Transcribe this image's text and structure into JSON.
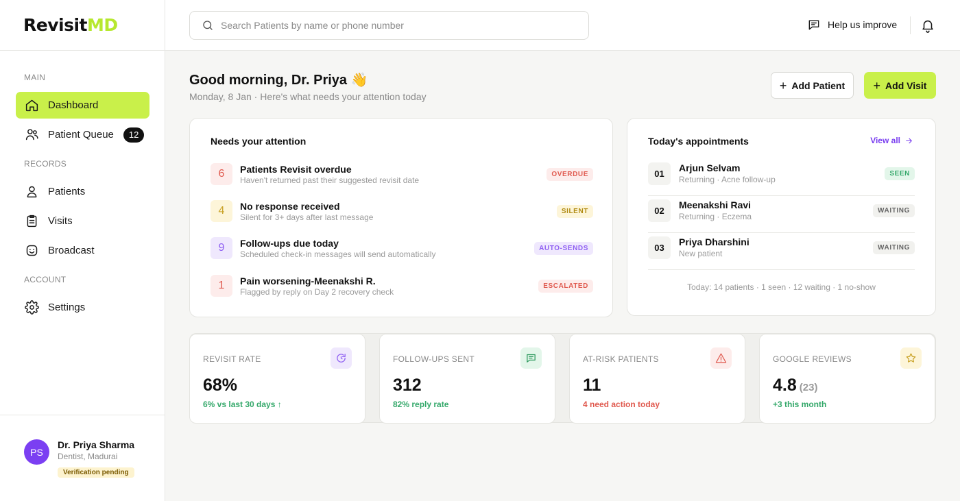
{
  "logo": {
    "part1": "Revisit",
    "part2": "MD"
  },
  "sidebar": {
    "sections": [
      "MAIN",
      "RECORDS",
      "ACCOUNT"
    ],
    "items": [
      {
        "label": "Dashboard"
      },
      {
        "label": "Patient Queue",
        "badge": "12"
      },
      {
        "label": "Patients"
      },
      {
        "label": "Visits"
      },
      {
        "label": "Broadcast"
      },
      {
        "label": "Settings"
      }
    ],
    "profile": {
      "initials": "PS",
      "name": "Dr. Priya Sharma",
      "role": "Dentist, Madurai",
      "status": "Verification pending"
    }
  },
  "topbar": {
    "search_placeholder": "Search Patients by name or phone number",
    "help_label": "Help us improve"
  },
  "header": {
    "greeting": "Good morning, Dr. Priya 👋",
    "subtitle": "Monday, 8 Jan · Here's what needs your attention today",
    "add_patient": "Add Patient",
    "add_visit": "Add Visit"
  },
  "attention": {
    "title": "Needs your attention",
    "items": [
      {
        "count": "6",
        "title": "Patients Revisit overdue",
        "sub": "Haven't returned past their suggested revisit date",
        "tag": "OVERDUE"
      },
      {
        "count": "4",
        "title": "No response received",
        "sub": "Silent for 3+ days after last message",
        "tag": "SILENT"
      },
      {
        "count": "9",
        "title": "Follow-ups due today",
        "sub": "Scheduled check-in messages will send automatically",
        "tag": "AUTO-SENDS"
      },
      {
        "count": "1",
        "title": "Pain worsening-Meenakshi R.",
        "sub": "Flagged by reply on Day 2 recovery check",
        "tag": "ESCALATED"
      }
    ]
  },
  "appointments": {
    "title": "Today's appointments",
    "view_all": "View all",
    "items": [
      {
        "num": "01",
        "name": "Arjun Selvam",
        "sub": "Returning · Acne follow-up",
        "status": "SEEN"
      },
      {
        "num": "02",
        "name": "Meenakshi Ravi",
        "sub": "Returning · Eczema",
        "status": "WAITING"
      },
      {
        "num": "03",
        "name": "Priya Dharshini",
        "sub": "New patient",
        "status": "WAITING"
      }
    ],
    "footer": "Today: 14 patients · 1 seen · 12 waiting · 1 no-show"
  },
  "stats": [
    {
      "label": "REVISIT RATE",
      "value": "68%",
      "note": "6% vs last 30 days ↑",
      "icon": "refresh-icon"
    },
    {
      "label": "FOLLOW-UPS SENT",
      "value": "312",
      "note": "82% reply rate",
      "icon": "message-icon"
    },
    {
      "label": "AT-RISK PATIENTS",
      "value": "11",
      "note": "4 need action today",
      "icon": "warning-icon"
    },
    {
      "label": "GOOGLE REVIEWS",
      "value": "4.8",
      "value_extra": "(23)",
      "note": "+3 this month",
      "icon": "star-icon"
    }
  ],
  "colors": {
    "accent": "#c9f04a",
    "purple": "#7a3ff0",
    "green_text": "#34a86a",
    "red_text": "#e05a4f"
  }
}
